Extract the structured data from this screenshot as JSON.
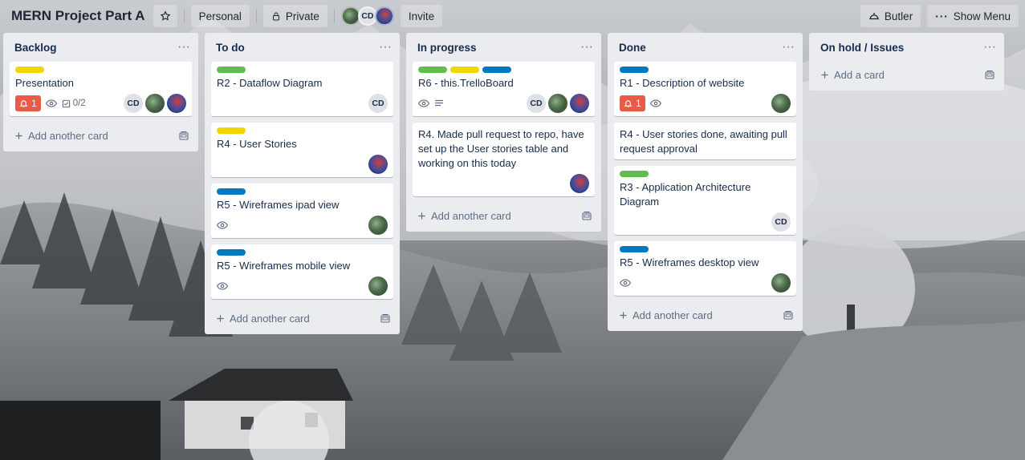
{
  "board": {
    "title": "MERN Project Part A",
    "visibility_team": "Personal",
    "visibility": "Private",
    "invite_label": "Invite",
    "butler_label": "Butler",
    "show_menu_label": "Show Menu",
    "member_initials": "CD"
  },
  "colors": {
    "label_yellow": "#f2d600",
    "label_green": "#61bd4f",
    "label_blue": "#0079bf",
    "badge_red": "#eb5a46",
    "list_bg": "#ebecf0"
  },
  "lists": [
    {
      "title": "Backlog",
      "add_label": "Add another card",
      "cards": [
        {
          "title": "Presentation",
          "labels": [
            "yellow"
          ],
          "notification": "1",
          "watch": true,
          "checklist": "0/2",
          "members": [
            "CD",
            "pic1",
            "pic2"
          ]
        }
      ]
    },
    {
      "title": "To do",
      "add_label": "Add another card",
      "cards": [
        {
          "title": "R2 - Dataflow Diagram",
          "labels": [
            "green"
          ],
          "members": [
            "CD"
          ]
        },
        {
          "title": "R4 - User Stories",
          "labels": [
            "yellow"
          ],
          "members": [
            "pic2"
          ]
        },
        {
          "title": "R5 - Wireframes ipad view",
          "labels": [
            "blue"
          ],
          "watch": true,
          "members": [
            "pic1"
          ]
        },
        {
          "title": "R5 - Wireframes mobile view",
          "labels": [
            "blue"
          ],
          "watch": true,
          "members": [
            "pic1"
          ]
        }
      ]
    },
    {
      "title": "In progress",
      "add_label": "Add another card",
      "cards": [
        {
          "title": "R6 - this.TrelloBoard",
          "labels": [
            "green",
            "yellow",
            "blue"
          ],
          "watch": true,
          "description": true,
          "members": [
            "CD",
            "pic1",
            "pic2"
          ]
        },
        {
          "title": "R4. Made pull request to repo, have set up the User stories table and working on this today",
          "labels": [],
          "members": [
            "pic2"
          ]
        }
      ]
    },
    {
      "title": "Done",
      "add_label": "Add another card",
      "cards": [
        {
          "title": "R1 - Description of website",
          "labels": [
            "blue"
          ],
          "notification": "1",
          "watch": true,
          "members": [
            "pic1"
          ]
        },
        {
          "title": "R4 - User stories done, awaiting pull request approval",
          "labels": [],
          "members": []
        },
        {
          "title": "R3 - Application Architecture Diagram",
          "labels": [
            "green"
          ],
          "members": [
            "CD"
          ]
        },
        {
          "title": "R5 - Wireframes desktop view",
          "labels": [
            "blue"
          ],
          "watch": true,
          "members": [
            "pic1"
          ]
        }
      ]
    },
    {
      "title": "On hold / Issues",
      "add_label": "Add a card",
      "cards": []
    }
  ]
}
